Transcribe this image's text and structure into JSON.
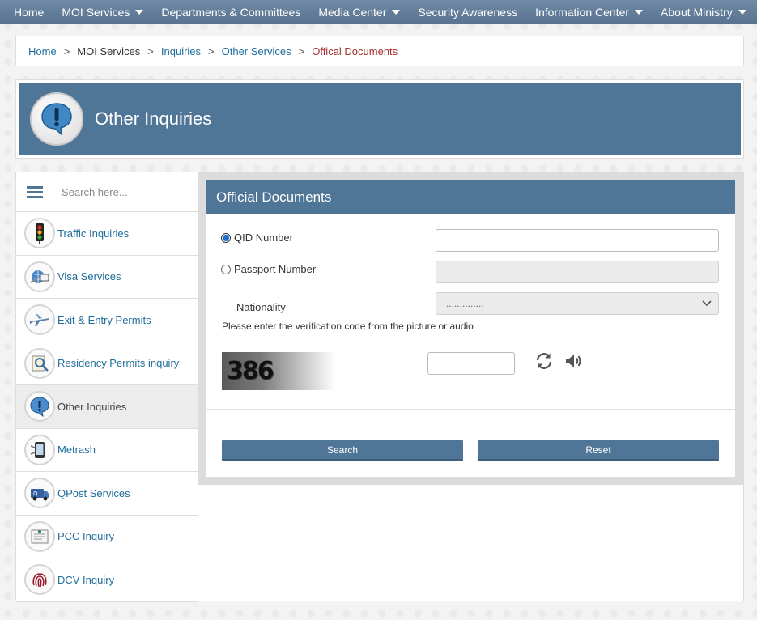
{
  "nav": {
    "items": [
      {
        "label": "Home",
        "has_dropdown": false
      },
      {
        "label": "MOI Services",
        "has_dropdown": true
      },
      {
        "label": "Departments & Committees",
        "has_dropdown": false
      },
      {
        "label": "Media Center",
        "has_dropdown": true
      },
      {
        "label": "Security Awareness",
        "has_dropdown": false
      },
      {
        "label": "Information Center",
        "has_dropdown": true
      },
      {
        "label": "About Ministry",
        "has_dropdown": true
      }
    ]
  },
  "breadcrumb": {
    "home": "Home",
    "moi_services": "MOI Services",
    "inquiries": "Inquiries",
    "other_services": "Other Services",
    "current": "Offical Documents",
    "separator": ">"
  },
  "banner": {
    "title": "Other Inquiries",
    "icon": "exclamation-speech-bubble-icon"
  },
  "sidebar": {
    "search_placeholder": "Search here...",
    "items": [
      {
        "label": "Traffic Inquiries",
        "icon": "traffic-light-icon",
        "active": false
      },
      {
        "label": "Visa Services",
        "icon": "visa-icon",
        "active": false
      },
      {
        "label": "Exit & Entry Permits",
        "icon": "airplane-icon",
        "active": false
      },
      {
        "label": "Residency Permits inquiry",
        "icon": "residency-icon",
        "active": false
      },
      {
        "label": "Other Inquiries",
        "icon": "exclamation-icon",
        "active": true
      },
      {
        "label": "Metrash",
        "icon": "metrash-icon",
        "active": false
      },
      {
        "label": "QPost Services",
        "icon": "qpost-van-icon",
        "active": false
      },
      {
        "label": "PCC Inquiry",
        "icon": "certificate-icon",
        "active": false
      },
      {
        "label": "DCV Inquiry",
        "icon": "fingerprint-icon",
        "active": false
      }
    ]
  },
  "form": {
    "title": "Official Documents",
    "qid_label": "QID Number",
    "passport_label": "Passport Number",
    "nationality_label": "Nationality",
    "nationality_selected": "..............",
    "verification_text": "Please enter the verification code from the picture or audio",
    "captcha_code": "386",
    "search_button": "Search",
    "reset_button": "Reset",
    "selected_option": "QID Number"
  },
  "colors": {
    "accent": "#4f7597",
    "link": "#1f6d9c",
    "breadcrumb_current": "#a03030"
  }
}
